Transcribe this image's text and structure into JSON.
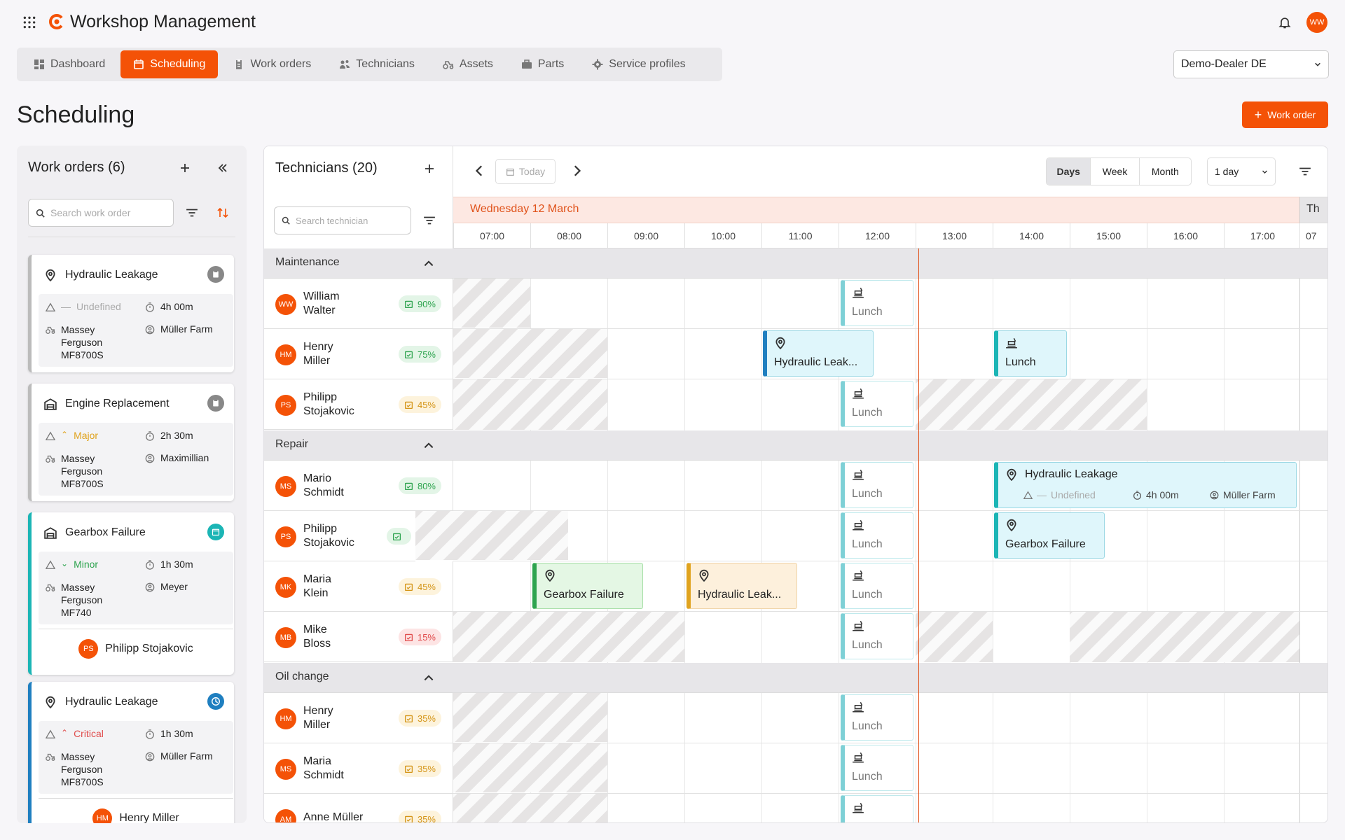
{
  "app": {
    "title": "Workshop Management",
    "user_initials": "WW"
  },
  "nav": {
    "tabs": [
      {
        "label": "Dashboard",
        "icon": "dashboard-icon"
      },
      {
        "label": "Scheduling",
        "icon": "calendar-icon",
        "active": true
      },
      {
        "label": "Work orders",
        "icon": "clipboard-icon"
      },
      {
        "label": "Technicians",
        "icon": "people-icon"
      },
      {
        "label": "Assets",
        "icon": "tractor-icon"
      },
      {
        "label": "Parts",
        "icon": "toolbox-icon"
      },
      {
        "label": "Service profiles",
        "icon": "gear-icon"
      }
    ]
  },
  "dealer": {
    "value": "Demo-Dealer DE"
  },
  "page": {
    "title": "Scheduling",
    "new_button": "Work order"
  },
  "work_orders": {
    "title": "Work orders (6)",
    "search_placeholder": "Search work order",
    "cards": [
      {
        "title": "Hydraulic Leakage",
        "priority": "Undefined",
        "duration": "4h 00m",
        "asset": "Massey Ferguson MF8700S",
        "customer": "Müller Farm"
      },
      {
        "title": "Engine Replacement",
        "priority": "Major",
        "duration": "2h 30m",
        "asset": "Massey Ferguson MF8700S",
        "customer": "Maximillian"
      },
      {
        "title": "Gearbox Failure",
        "priority": "Minor",
        "duration": "1h 30m",
        "asset": "Massey Ferguson MF740",
        "customer": "Meyer",
        "assignee": "Philipp Stojakovic",
        "assignee_initials": "PS"
      },
      {
        "title": "Hydraulic Leakage",
        "priority": "Critical",
        "duration": "1h 30m",
        "asset": "Massey Ferguson MF8700S",
        "customer": "Müller Farm",
        "assignee": "Henry Miller",
        "assignee_initials": "HM"
      }
    ]
  },
  "technicians": {
    "title": "Technicians (20)",
    "search_placeholder": "Search technician",
    "groups": [
      {
        "name": "Maintenance",
        "rows": [
          {
            "initials": "WW",
            "first": "William",
            "last": "Walter",
            "util": "90%",
            "level": "green"
          },
          {
            "initials": "HM",
            "first": "Henry",
            "last": "Miller",
            "util": "75%",
            "level": "green"
          },
          {
            "initials": "PS",
            "first": "Philipp",
            "last": "Stojakovic",
            "util": "45%",
            "level": "yellow"
          }
        ]
      },
      {
        "name": "Repair",
        "rows": [
          {
            "initials": "MS",
            "first": "Mario",
            "last": "Schmidt",
            "util": "80%",
            "level": "green"
          },
          {
            "initials": "PS",
            "first": "Philipp",
            "last": "Stojakovic",
            "util": "",
            "level": "green"
          },
          {
            "initials": "MK",
            "first": "Maria",
            "last": "Klein",
            "util": "45%",
            "level": "yellow"
          },
          {
            "initials": "MB",
            "first": "Mike",
            "last": "Bloss",
            "util": "15%",
            "level": "red"
          }
        ]
      },
      {
        "name": "Oil change",
        "rows": [
          {
            "initials": "HM",
            "first": "Henry",
            "last": "Miller",
            "util": "35%",
            "level": "yellow"
          },
          {
            "initials": "MS",
            "first": "Maria",
            "last": "Schmidt",
            "util": "35%",
            "level": "yellow"
          },
          {
            "initials": "AM",
            "first": "Anne Müller",
            "last": "",
            "util": "35%",
            "level": "yellow"
          }
        ]
      }
    ]
  },
  "calendar": {
    "today_label": "Today",
    "views": [
      "Days",
      "Week",
      "Month"
    ],
    "active_view": "Days",
    "range": "1 day",
    "date": "Wednesday 12 March",
    "next_date": "Th",
    "hours": [
      "07:00",
      "08:00",
      "09:00",
      "10:00",
      "11:00",
      "12:00",
      "13:00",
      "14:00",
      "15:00",
      "16:00",
      "17:00",
      "07"
    ],
    "lunch_label": "Lunch",
    "events": {
      "henry_hydraulic": "Hydraulic Leak...",
      "mario_hydraulic": "Hydraulic Leakage",
      "mario_priority": "Undefined",
      "mario_duration": "4h 00m",
      "mario_customer": "Müller Farm",
      "philipp_gearbox": "Gearbox Failure",
      "maria_gearbox": "Gearbox Failure",
      "maria_hydraulic": "Hydraulic Leak..."
    }
  },
  "colors": {
    "accent": "#f45207",
    "green": "#2ea44f",
    "yellow": "#e0a31e",
    "red": "#e04b4b",
    "teal": "#1bb5b5",
    "blue": "#1f7fc0"
  }
}
